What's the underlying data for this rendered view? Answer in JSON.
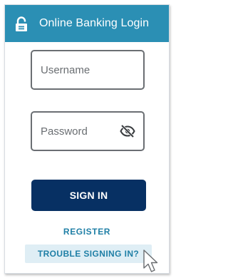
{
  "header": {
    "title": "Online Banking Login",
    "color": "#2b8fb4"
  },
  "form": {
    "username_placeholder": "Username",
    "password_placeholder": "Password"
  },
  "buttons": {
    "sign_in": "SIGN IN",
    "sign_in_color": "#073063"
  },
  "links": {
    "register": "REGISTER",
    "trouble": "TROUBLE SIGNING IN?",
    "color": "#1f7fa6"
  },
  "icons": {
    "header": "lock-icon",
    "password_toggle": "eye-slash-icon",
    "pointer": "mouse-cursor-icon"
  }
}
